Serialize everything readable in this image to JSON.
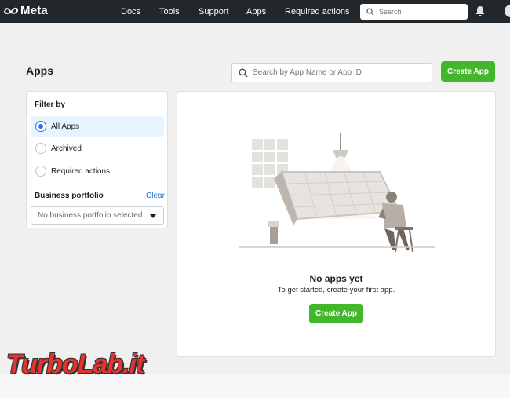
{
  "topbar": {
    "brand": "Meta",
    "nav": [
      "Docs",
      "Tools",
      "Support",
      "Apps",
      "Required actions"
    ],
    "search_placeholder": "Search",
    "icons": [
      "meta-logo-icon",
      "search-icon",
      "bell-icon",
      "avatar"
    ]
  },
  "header": {
    "title": "Apps",
    "search_placeholder": "Search by App Name or App ID",
    "create_label": "Create App"
  },
  "filter": {
    "title": "Filter by",
    "options": [
      {
        "label": "All Apps",
        "selected": true
      },
      {
        "label": "Archived",
        "selected": false
      },
      {
        "label": "Required actions",
        "selected": false
      }
    ],
    "business_title": "Business portfolio",
    "clear_label": "Clear",
    "business_value": "No business portfolio selected"
  },
  "empty": {
    "title": "No apps yet",
    "subtitle": "To get started, create your first app.",
    "create_label": "Create App"
  },
  "watermark": "TurboLab.it",
  "colors": {
    "topbar": "#22272b",
    "accent_green": "#42b72a",
    "link_blue": "#216fdb",
    "selected_bg": "#e7f3ff",
    "watermark_red": "#e3342f"
  }
}
